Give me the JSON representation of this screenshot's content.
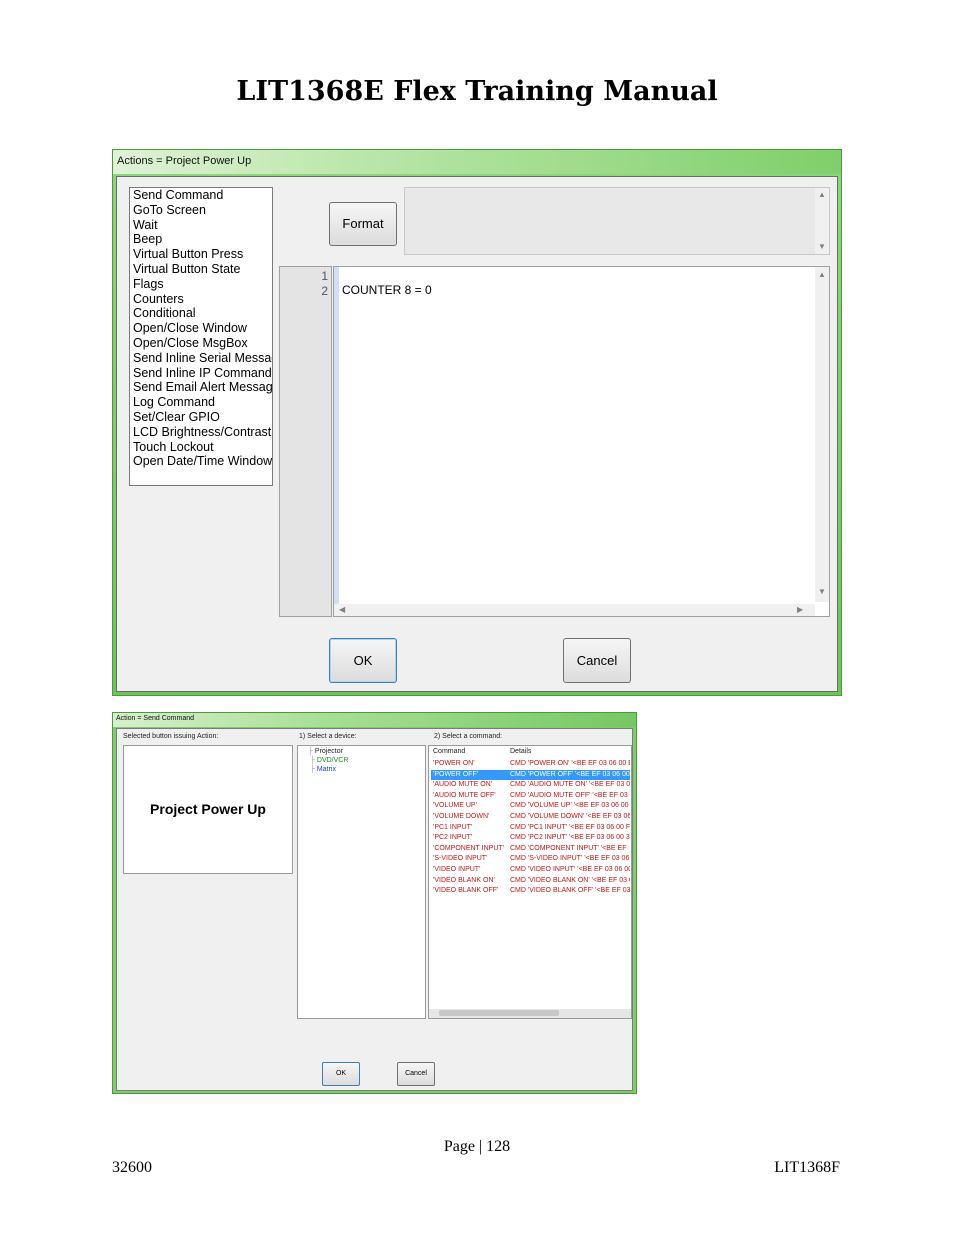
{
  "document": {
    "title": "LIT1368E Flex Training Manual",
    "page_label": "Page | 128",
    "footer_left": "32600",
    "footer_right": "LIT1368F"
  },
  "window1": {
    "title": "Actions = Project Power Up",
    "actions": [
      "Send Command",
      "GoTo Screen",
      "Wait",
      "Beep",
      "Virtual Button Press",
      "Virtual Button State",
      "Flags",
      "Counters",
      "Conditional",
      "Open/Close Window",
      "Open/Close MsgBox",
      "Send Inline Serial Message",
      "Send Inline IP Command",
      "Send Email Alert Message",
      "Log Command",
      "Set/Clear GPIO",
      "LCD Brightness/Contrast",
      "Touch Lockout",
      "Open Date/Time Window"
    ],
    "format_button": "Format",
    "line_numbers": [
      "1",
      "2"
    ],
    "code_lines": [
      "COUNTER 8 = 0"
    ],
    "ok_button": "OK",
    "cancel_button": "Cancel"
  },
  "window2": {
    "title": "Action = Send Command",
    "selected_label": "Selected button issuing Action:",
    "selected_button": "Project Power Up",
    "device_label": "1) Select a device:",
    "devices": [
      {
        "name": "Projector",
        "color": "#222222"
      },
      {
        "name": "DVD/VCR",
        "color": "#1a8a1a"
      },
      {
        "name": "Matrix",
        "color": "#1a3acb"
      }
    ],
    "command_label": "2) Select a command:",
    "columns": [
      "Command",
      "Details"
    ],
    "commands": [
      {
        "command": "'POWER ON'",
        "details": "CMD 'POWER ON' '<BE EF 03 06 00 E"
      },
      {
        "command": "'POWER OFF'",
        "details": "CMD 'POWER OFF' '<BE EF 03 06 00",
        "selected": true
      },
      {
        "command": "'AUDIO MUTE ON'",
        "details": "CMD 'AUDIO MUTE ON' '<BE EF 03 0"
      },
      {
        "command": "'AUDIO MUTE OFF'",
        "details": "CMD 'AUDIO MUTE OFF' '<BE EF 03"
      },
      {
        "command": "'VOLUME UP'",
        "details": "CMD 'VOLUME UP' '<BE EF 03 06 00 I"
      },
      {
        "command": "'VOLUME DOWN'",
        "details": "CMD 'VOLUME DOWN' '<BE EF 03 06"
      },
      {
        "command": "'PC1 INPUT'",
        "details": "CMD 'PC1 INPUT' '<BE EF 03 06 00 FE"
      },
      {
        "command": "'PC2 INPUT'",
        "details": "CMD 'PC2 INPUT' '<BE EF 03 06 00 3E"
      },
      {
        "command": "'COMPONENT INPUT'",
        "details": "CMD 'COMPONENT INPUT' '<BE EF"
      },
      {
        "command": "'S-VIDEO INPUT'",
        "details": "CMD 'S-VIDEO INPUT' '<BE EF 03 06"
      },
      {
        "command": "'VIDEO INPUT'",
        "details": "CMD 'VIDEO INPUT' '<BE EF 03 06 00"
      },
      {
        "command": "'VIDEO BLANK ON'",
        "details": "CMD 'VIDEO BLANK ON' '<BE EF 03 0"
      },
      {
        "command": "'VIDEO BLANK OFF'",
        "details": "CMD 'VIDEO BLANK OFF' '<BE EF 03"
      }
    ],
    "ok_button": "OK",
    "cancel_button": "Cancel"
  }
}
